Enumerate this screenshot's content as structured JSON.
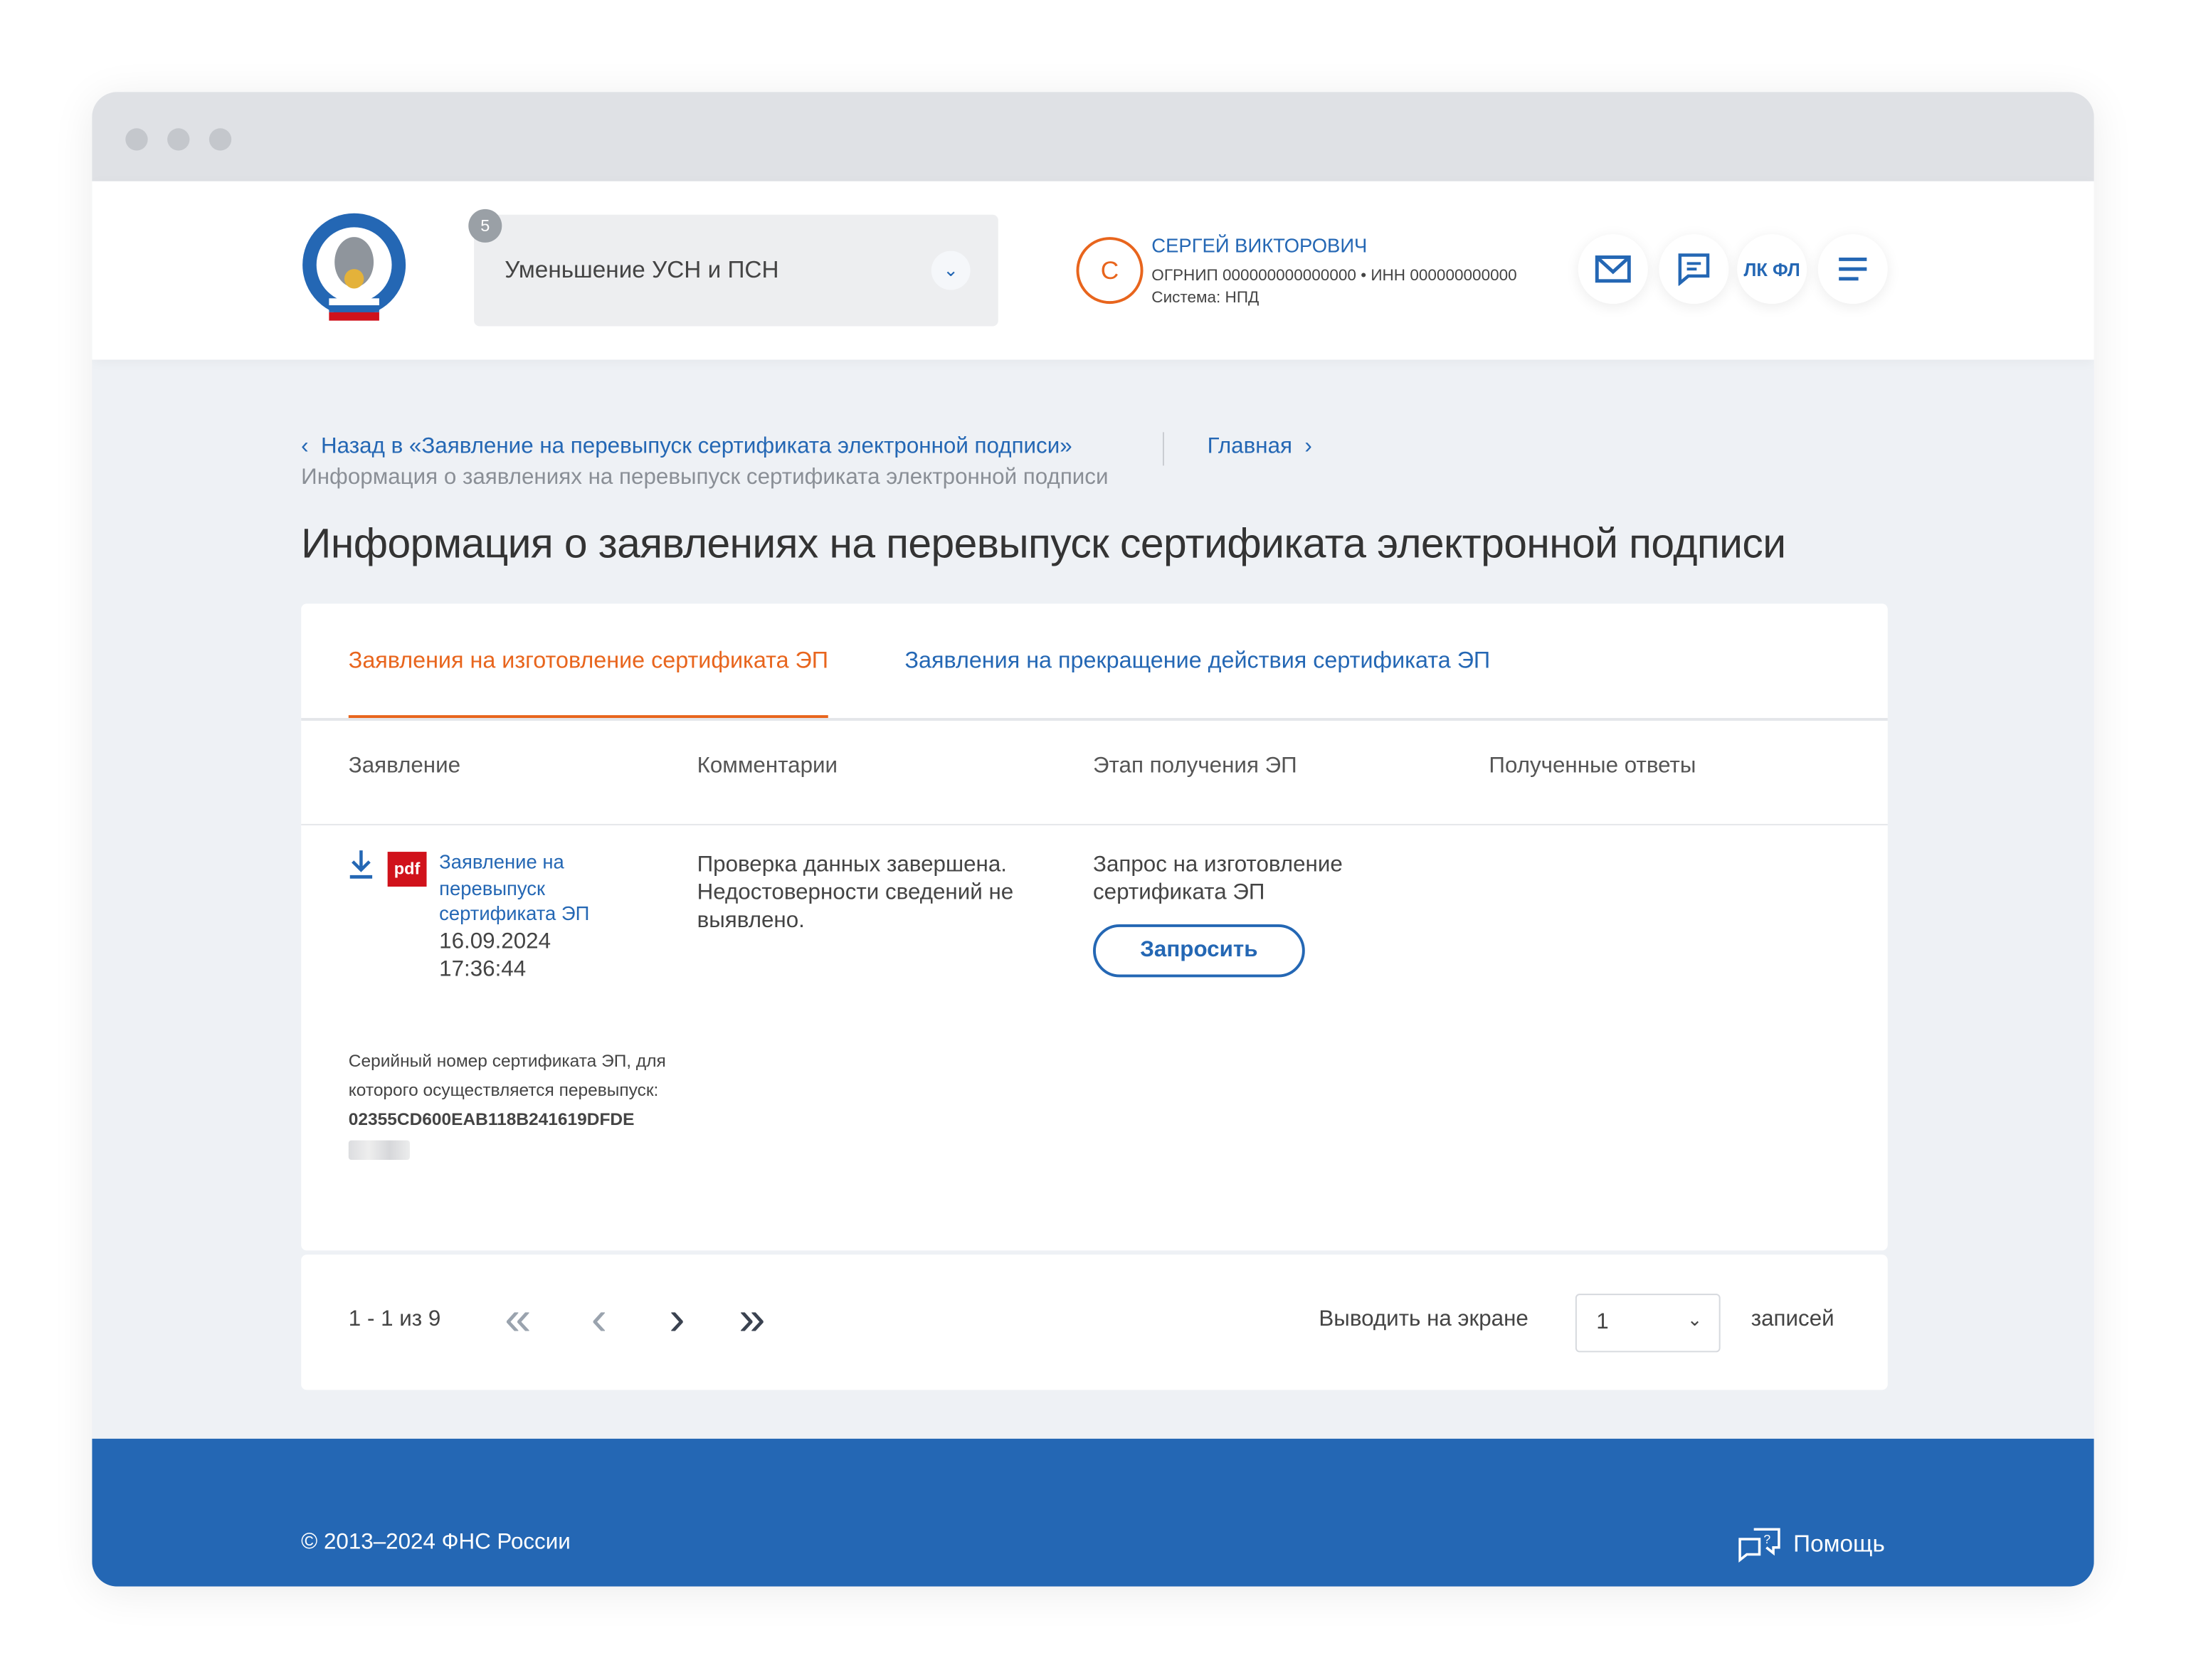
{
  "header": {
    "service_select": {
      "value": "Уменьшение УСН и ПСН",
      "badge": "5"
    },
    "user": {
      "initial": "С",
      "name": "СЕРГЕЙ ВИКТОРОВИЧ",
      "ids": "ОГРНИП 000000000000000 • ИНН 000000000000",
      "system": "Система: НПД"
    },
    "buttons": {
      "lk_fl": "ЛК ФЛ"
    }
  },
  "breadcrumb": {
    "back": "Назад в «Заявление на перевыпуск сертификата электронной подписи»",
    "home": "Главная",
    "current": "Информация о заявлениях на перевыпуск сертификата электронной подписи"
  },
  "page_title": "Информация о заявлениях на перевыпуск сертификата электронной подписи",
  "tabs": [
    {
      "label": "Заявления на изготовление сертификата ЭП",
      "active": true
    },
    {
      "label": "Заявления на прекращение действия сертификата ЭП",
      "active": false
    }
  ],
  "table": {
    "columns": [
      "Заявление",
      "Комментарии",
      "Этап получения ЭП",
      "Полученные ответы"
    ],
    "rows": [
      {
        "doc_link": "Заявление на перевыпуск сертификата ЭП",
        "pdf_label": "pdf",
        "date": "16.09.2024",
        "time": "17:36:44",
        "comment": "Проверка данных завершена. Недостоверности сведений не выявлено.",
        "stage": "Запрос на изготовление сертификата ЭП",
        "stage_button": "Запросить",
        "answers": "",
        "serial_label": "Серийный номер сертификата ЭП, для которого осуществляется перевыпуск:",
        "serial": "02355CD600EAB118B241619DFDE"
      }
    ]
  },
  "pagination": {
    "range": "1 - 1 из 9",
    "per_page_label": "Выводить на экране",
    "per_page_value": "1",
    "records_label": "записей"
  },
  "footer": {
    "copyright": "© 2013–2024 ФНС России",
    "help": "Помощь"
  },
  "colors": {
    "accent": "#e8651d",
    "brand": "#2467b4"
  }
}
